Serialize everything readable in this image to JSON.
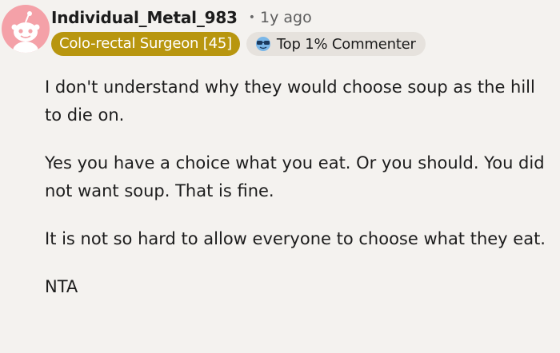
{
  "comment": {
    "username": "Individual_Metal_983",
    "separator": "•",
    "timestamp": "1y ago",
    "flair": "Colo-rectal Surgeon [45]",
    "badge_label": "Top 1% Commenter",
    "badge_icon": "sunglasses-face-icon",
    "avatar_icon": "snoo-avatar-icon",
    "paragraphs": [
      "I don't understand why they would choose soup as the hill to die on.",
      "Yes you have a choice what you eat. Or you should. You did not want soup. That is fine.",
      "It is not so hard to allow everyone to choose what they eat.",
      "NTA"
    ]
  },
  "colors": {
    "background": "#f4f2ef",
    "avatar_bg": "#f4a1a8",
    "flair_bg": "#b8960f",
    "badge_bg": "#e6e2dd"
  }
}
